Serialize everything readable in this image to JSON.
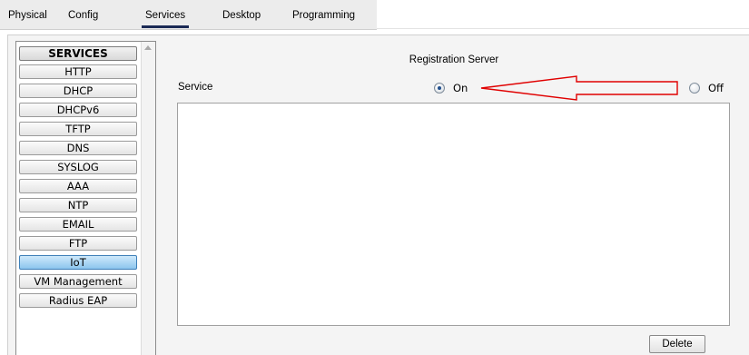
{
  "tabs": [
    {
      "label": "Physical",
      "active": false
    },
    {
      "label": "Config",
      "active": false
    },
    {
      "label": "Services",
      "active": true
    },
    {
      "label": "Desktop",
      "active": false
    },
    {
      "label": "Programming",
      "active": false
    }
  ],
  "sidebar": {
    "header": "SERVICES",
    "items": [
      {
        "label": "HTTP"
      },
      {
        "label": "DHCP"
      },
      {
        "label": "DHCPv6"
      },
      {
        "label": "TFTP"
      },
      {
        "label": "DNS"
      },
      {
        "label": "SYSLOG"
      },
      {
        "label": "AAA"
      },
      {
        "label": "NTP"
      },
      {
        "label": "EMAIL"
      },
      {
        "label": "FTP"
      },
      {
        "label": "IoT",
        "selected": true
      },
      {
        "label": "VM Management"
      },
      {
        "label": "Radius EAP"
      }
    ]
  },
  "main": {
    "title": "Registration Server",
    "service_label": "Service",
    "radio_on_label": "On",
    "radio_off_label": "Off",
    "selected_radio": "On",
    "delete_label": "Delete"
  },
  "colors": {
    "accent_tab_underline": "#1b2a55",
    "selected_item": "#8cc5ee",
    "annotation_arrow": "#e00000"
  }
}
